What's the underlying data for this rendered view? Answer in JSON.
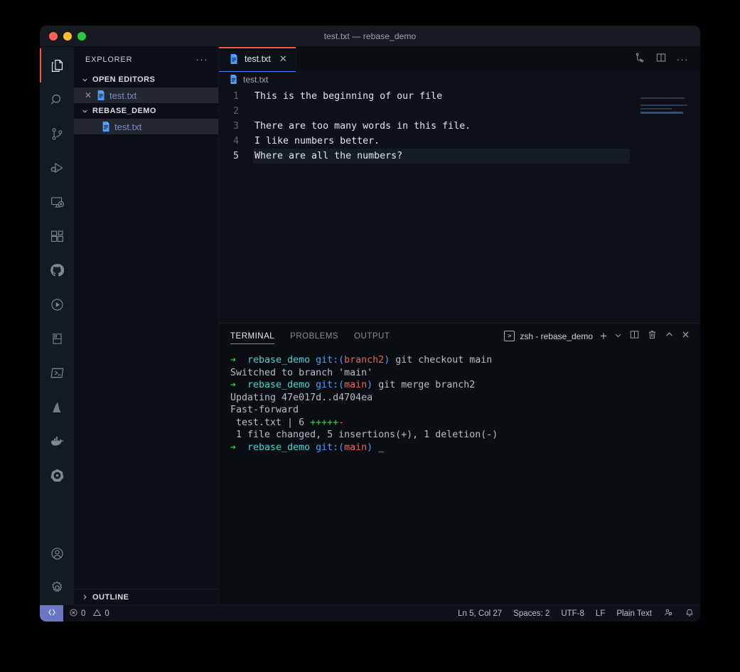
{
  "window": {
    "title": "test.txt — rebase_demo",
    "traffic": [
      "close",
      "minimize",
      "zoom"
    ]
  },
  "activitybar": {
    "items": [
      {
        "name": "explorer",
        "icon": "files-icon",
        "active": true
      },
      {
        "name": "search",
        "icon": "search-icon",
        "active": false
      },
      {
        "name": "source-control",
        "icon": "source-control-icon",
        "active": false
      },
      {
        "name": "run-and-debug",
        "icon": "run-debug-icon",
        "active": false
      },
      {
        "name": "remote-explorer",
        "icon": "remote-explorer-icon",
        "active": false
      },
      {
        "name": "extensions",
        "icon": "extensions-icon",
        "active": false
      },
      {
        "name": "github",
        "icon": "github-icon",
        "active": false
      },
      {
        "name": "test-player",
        "icon": "play-circle-icon",
        "active": false
      },
      {
        "name": "database",
        "icon": "database-icon",
        "active": false
      },
      {
        "name": "terminal-tool",
        "icon": "powershell-icon",
        "active": false
      },
      {
        "name": "azure",
        "icon": "azure-icon",
        "active": false
      },
      {
        "name": "docker",
        "icon": "docker-icon",
        "active": false
      },
      {
        "name": "kubernetes",
        "icon": "kubernetes-icon",
        "active": false
      }
    ],
    "bottom": [
      {
        "name": "accounts",
        "icon": "account-icon"
      },
      {
        "name": "manage-settings",
        "icon": "gear-icon"
      }
    ]
  },
  "sidebar": {
    "title": "EXPLORER",
    "more_actions": "···",
    "sections": [
      {
        "label": "OPEN EDITORS",
        "expanded": true,
        "chevron": "chevron-down",
        "items": [
          {
            "label": "test.txt",
            "selected": true,
            "has_close": true,
            "close_glyph": "✕"
          }
        ]
      },
      {
        "label": "REBASE_DEMO",
        "expanded": true,
        "chevron": "chevron-down",
        "items": [
          {
            "label": "test.txt",
            "selected": true,
            "has_close": false,
            "close_glyph": ""
          }
        ]
      }
    ],
    "outline": {
      "label": "OUTLINE",
      "expanded": false,
      "chevron": "chevron-right"
    }
  },
  "editor": {
    "tabs": [
      {
        "label": "test.txt",
        "active": true,
        "close_glyph": "✕",
        "icon": "txt-file-icon"
      }
    ],
    "actions": [
      {
        "name": "open-changes-icon",
        "glyph": "compare"
      },
      {
        "name": "split-editor-icon",
        "glyph": "split"
      },
      {
        "name": "more-actions-icon",
        "glyph": "···"
      }
    ],
    "breadcrumb": "test.txt",
    "lines": [
      {
        "num": "1",
        "text": "This is the beginning of our file",
        "active": false
      },
      {
        "num": "2",
        "text": "",
        "active": false
      },
      {
        "num": "3",
        "text": "There are too many words in this file.",
        "active": false
      },
      {
        "num": "4",
        "text": "I like numbers better.",
        "active": false
      },
      {
        "num": "5",
        "text": "Where are all the numbers?",
        "active": true
      }
    ]
  },
  "panel": {
    "tabs": [
      {
        "label": "TERMINAL",
        "active": true
      },
      {
        "label": "PROBLEMS",
        "active": false
      },
      {
        "label": "OUTPUT",
        "active": false
      }
    ],
    "terminal_instance": "zsh - rebase_demo",
    "actions": [
      {
        "name": "new-terminal-icon",
        "glyph": "+"
      },
      {
        "name": "terminal-dropdown-icon",
        "glyph": "∨"
      },
      {
        "name": "split-terminal-icon",
        "glyph": "split"
      },
      {
        "name": "kill-terminal-icon",
        "glyph": "trash"
      },
      {
        "name": "maximize-panel-icon",
        "glyph": "∧"
      },
      {
        "name": "close-panel-icon",
        "glyph": "✕"
      }
    ],
    "terminal_lines": [
      {
        "type": "prompt",
        "arrow": "➔",
        "dir": "rebase_demo",
        "git_prefix": "git:(",
        "branch": "branch2",
        "git_suffix": ")",
        "command": " git checkout main",
        "cursor": ""
      },
      {
        "type": "output",
        "text": "Switched to branch 'main'"
      },
      {
        "type": "prompt",
        "arrow": "➔",
        "dir": "rebase_demo",
        "git_prefix": "git:(",
        "branch": "main",
        "git_suffix": ")",
        "command": " git merge branch2",
        "cursor": ""
      },
      {
        "type": "output",
        "text": "Updating 47e017d..d4704ea"
      },
      {
        "type": "output",
        "text": "Fast-forward"
      },
      {
        "type": "diffstat",
        "file": " test.txt | 6 ",
        "plus": "+++++",
        "minus": "-"
      },
      {
        "type": "output",
        "text": " 1 file changed, 5 insertions(+), 1 deletion(-)"
      },
      {
        "type": "prompt",
        "arrow": "➔",
        "dir": "rebase_demo",
        "git_prefix": "git:(",
        "branch": "main",
        "git_suffix": ")",
        "command": "",
        "cursor": " _"
      }
    ]
  },
  "statusbar": {
    "remote_icon": "remote-window-icon",
    "errors": {
      "icon": "error-icon",
      "count": "0"
    },
    "warnings": {
      "icon": "warning-icon",
      "count": "0"
    },
    "cursor_position": "Ln 5, Col 27",
    "indentation": "Spaces: 2",
    "encoding": "UTF-8",
    "eol": "LF",
    "language": "Plain Text",
    "feedback_icon": "feedback-icon",
    "bell_icon": "bell-icon"
  },
  "colors": {
    "accent_orange": "#f2583e",
    "accent_blue": "#3b82f6",
    "remote_chip": "#6b77c4",
    "terminal_green": "#3ad94a",
    "terminal_cyan": "#4ad4d4",
    "terminal_blue": "#4a9eff",
    "terminal_red": "#e8645a"
  }
}
